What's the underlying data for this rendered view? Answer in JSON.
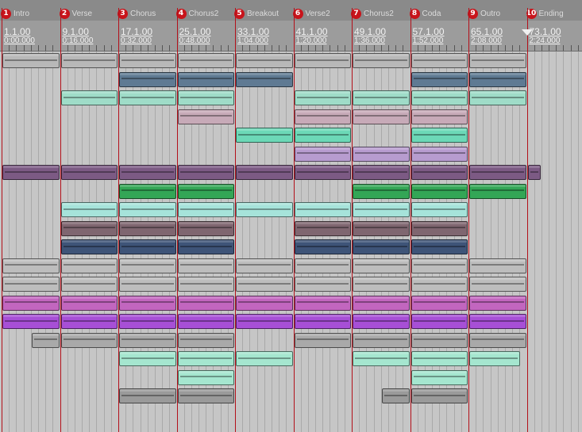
{
  "markers": [
    {
      "num": "1",
      "name": "Intro"
    },
    {
      "num": "2",
      "name": "Verse"
    },
    {
      "num": "3",
      "name": "Chorus"
    },
    {
      "num": "4",
      "name": "Chorus2"
    },
    {
      "num": "5",
      "name": "Breakout"
    },
    {
      "num": "6",
      "name": "Verse2"
    },
    {
      "num": "7",
      "name": "Chorus2"
    },
    {
      "num": "8",
      "name": "Coda"
    },
    {
      "num": "9",
      "name": "Outro"
    },
    {
      "num": "10",
      "name": "Ending"
    }
  ],
  "ruler": [
    {
      "pos": "1.1.00",
      "time": "0:00.000"
    },
    {
      "pos": "9.1.00",
      "time": "0:16.000"
    },
    {
      "pos": "17.1.00",
      "time": "0:32.000"
    },
    {
      "pos": "25.1.00",
      "time": "0:48.000"
    },
    {
      "pos": "33.1.00",
      "time": "1:04.000"
    },
    {
      "pos": "41.1.00",
      "time": "1:20.000"
    },
    {
      "pos": "49.1.00",
      "time": "1:36.000"
    },
    {
      "pos": "57.1.00",
      "time": "1:52.000"
    },
    {
      "pos": "65.1.00",
      "time": "2:08.000"
    },
    {
      "pos": "73.1.00",
      "time": "2:24.000"
    }
  ],
  "colors": {
    "marker_red": "#c8141b",
    "background": "#c6c6c6",
    "blue_gray": "#5f7a93",
    "mint": "#9fdcc8",
    "rose": "#c7aab8",
    "teal": "#6cd8b7",
    "lavender": "#b79ccf",
    "plum": "#7c5a84",
    "green": "#33a656",
    "aqua": "#a6e3da",
    "mauve": "#7f6670",
    "navy": "#3e5478",
    "magenta": "#c266bf",
    "violet": "#a74fd6",
    "gray": "#a9a9a9",
    "pale_mint": "#a5e6cf",
    "mid_gray": "#9a9a9a"
  },
  "tracks": [
    {
      "color": "#b8b8b8",
      "segments": [
        [
          0,
          9
        ]
      ]
    },
    {
      "color": "#5f7a93",
      "segments": [
        [
          2,
          5
        ],
        [
          7,
          9
        ]
      ]
    },
    {
      "color": "#9fdcc8",
      "segments": [
        [
          1,
          4
        ],
        [
          5,
          9
        ]
      ]
    },
    {
      "color": "#c7aab8",
      "segments": [
        [
          3,
          4
        ],
        [
          5,
          8
        ]
      ]
    },
    {
      "color": "#6cd8b7",
      "segments": [
        [
          4,
          6
        ],
        [
          7,
          8
        ]
      ]
    },
    {
      "color": "#b79ccf",
      "segments": [
        [
          5,
          8
        ]
      ]
    },
    {
      "color": "#7c5a84",
      "segments": [
        [
          0,
          9.25
        ]
      ]
    },
    {
      "color": "#33a656",
      "segments": [
        [
          2,
          4
        ],
        [
          6,
          9
        ]
      ]
    },
    {
      "color": "#a6e3da",
      "segments": [
        [
          1,
          8
        ]
      ]
    },
    {
      "color": "#7f6670",
      "segments": [
        [
          1,
          4
        ],
        [
          5,
          8
        ]
      ]
    },
    {
      "color": "#3e5478",
      "segments": [
        [
          1,
          4
        ],
        [
          5,
          8
        ]
      ]
    },
    {
      "color": "#bdbdbd",
      "segments": [
        [
          0,
          9
        ]
      ]
    },
    {
      "color": "#bdbdbd",
      "segments": [
        [
          0,
          9
        ]
      ]
    },
    {
      "color": "#c266bf",
      "segments": [
        [
          0,
          9
        ]
      ]
    },
    {
      "color": "#a74fd6",
      "segments": [
        [
          0,
          9
        ]
      ]
    },
    {
      "color": "#a9a9a9",
      "segments": [
        [
          0.5,
          1
        ],
        [
          1,
          4
        ],
        [
          5,
          9
        ]
      ]
    },
    {
      "color": "#a5e6cf",
      "segments": [
        [
          2,
          5
        ],
        [
          6,
          8.9
        ]
      ]
    },
    {
      "color": "#a5e6cf",
      "segments": [
        [
          3,
          4
        ],
        [
          7,
          8
        ]
      ]
    },
    {
      "color": "#9a9a9a",
      "segments": [
        [
          2,
          4
        ],
        [
          6.5,
          8
        ]
      ]
    }
  ]
}
